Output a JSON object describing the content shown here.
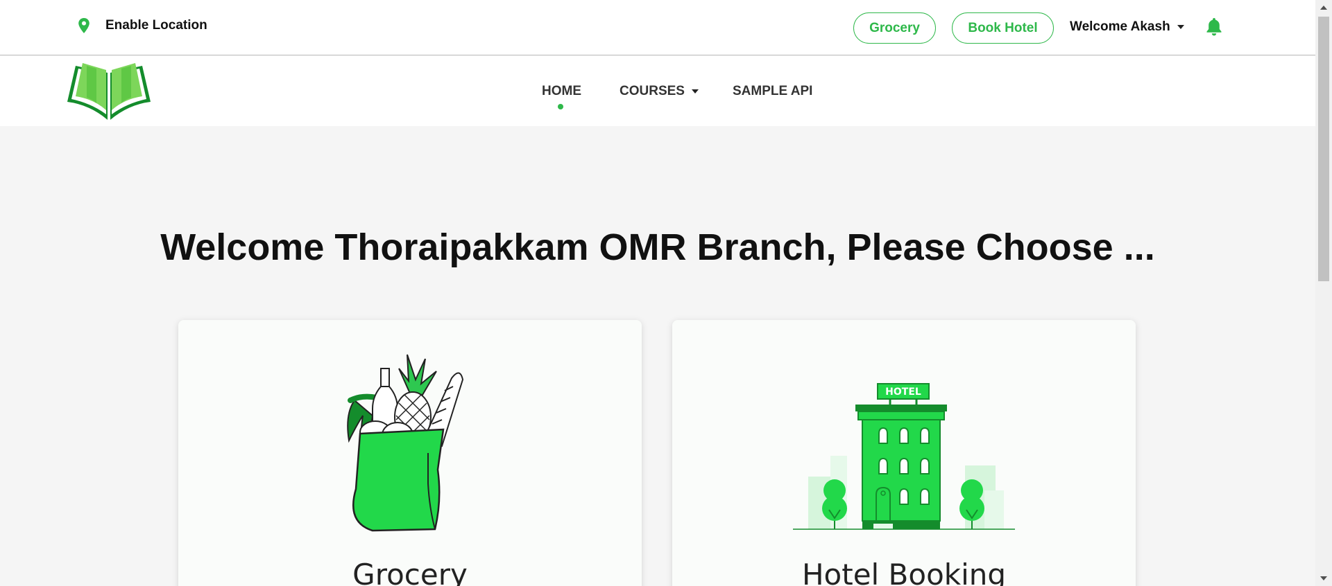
{
  "topbar": {
    "location_label": "Enable Location",
    "grocery_button": "Grocery",
    "hotel_button": "Book Hotel",
    "welcome_user": "Welcome Akash"
  },
  "nav": {
    "home": "HOME",
    "courses": "COURSES",
    "sample_api": "SAMPLE API"
  },
  "main": {
    "heading": "Welcome Thoraipakkam OMR Branch, Please Choose ...",
    "cards": [
      {
        "title": "Grocery",
        "image": "grocery-bag-illustration"
      },
      {
        "title": "Hotel Booking",
        "image": "hotel-building-illustration",
        "sign_text": "HOTEL"
      }
    ]
  },
  "colors": {
    "accent": "#2eb84a",
    "illustration_green": "#22d84a",
    "dark_green": "#148c2c"
  }
}
